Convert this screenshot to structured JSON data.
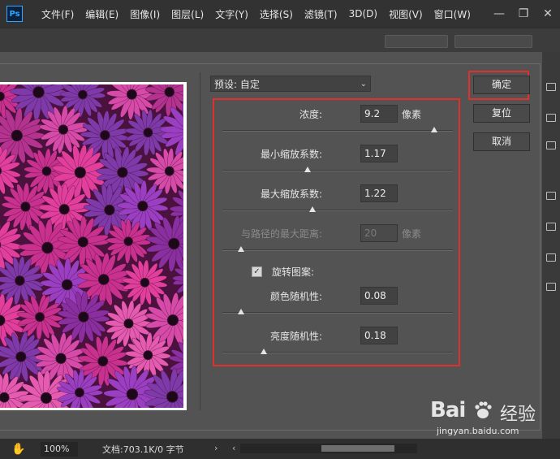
{
  "app": {
    "logo_text": "Ps",
    "menu": [
      "文件(F)",
      "编辑(E)",
      "图像(I)",
      "图层(L)",
      "文字(Y)",
      "选择(S)",
      "滤镜(T)",
      "3D(D)",
      "视图(V)",
      "窗口(W)"
    ],
    "window_controls": [
      "—",
      "❐",
      "✕"
    ]
  },
  "dialog": {
    "preset_label": "预设: 自定",
    "buttons": {
      "ok": "确定",
      "reset": "复位",
      "cancel": "取消"
    },
    "params": {
      "density": {
        "label": "浓度:",
        "value": "9.2",
        "unit": "像素",
        "slider": 0.92
      },
      "min_scale": {
        "label": "最小缩放系数:",
        "value": "1.17",
        "slider": 0.37
      },
      "max_scale": {
        "label": "最大缩放系数:",
        "value": "1.22",
        "slider": 0.39
      },
      "max_distance": {
        "label": "与路径的最大距离:",
        "value": "20",
        "unit": "像素",
        "slider": 0.08,
        "disabled": true
      },
      "rotate": {
        "label": "旋转图案:",
        "checked": true
      },
      "color_random": {
        "label": "颜色随机性:",
        "value": "0.08",
        "slider": 0.08
      },
      "brightness_random": {
        "label": "亮度随机性:",
        "value": "0.18",
        "slider": 0.18
      }
    }
  },
  "status": {
    "zoom": "100%",
    "doc_info": "文档:703.1K/0 字节",
    "arrow_right": "›",
    "arrow_left": "‹"
  },
  "watermark": {
    "brand": "Bai",
    "brand2": "经验",
    "url": "jingyan.baidu.com"
  },
  "colors": {
    "highlight": "#e0302b",
    "flower_pink": "#e23f9c",
    "flower_purple": "#9b3fc2"
  }
}
